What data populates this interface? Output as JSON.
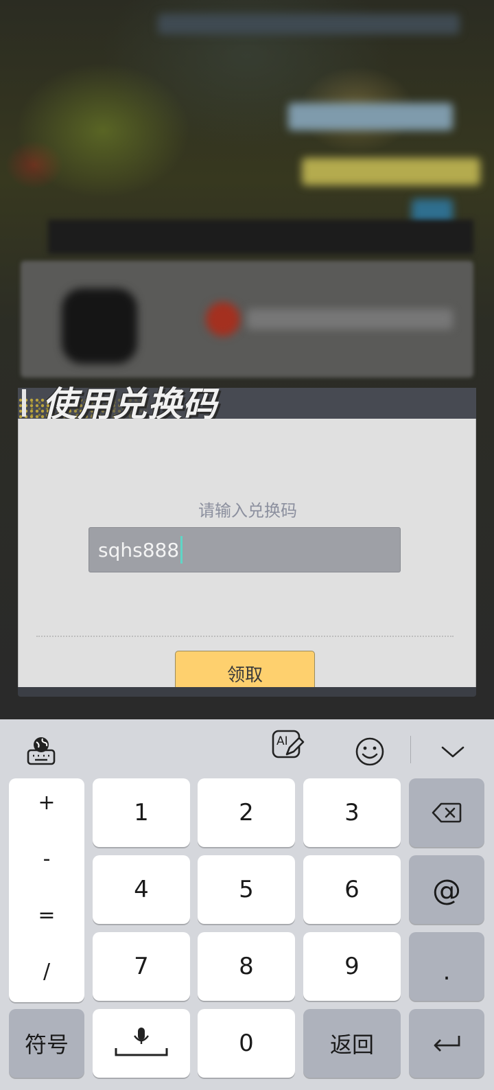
{
  "dialog": {
    "title": "使用兑换码",
    "prompt": "请输入兑换码",
    "input_value": "sqhs888",
    "claim_label": "领取"
  },
  "keyboard": {
    "toolbar": {
      "icons": [
        "keyboard-globe-icon",
        "ai-write-icon",
        "emoji-icon",
        "collapse-keyboard-icon"
      ],
      "ai_label": "AI"
    },
    "symbols": [
      "+",
      "-",
      "=",
      "/"
    ],
    "digits": [
      "1",
      "2",
      "3",
      "4",
      "5",
      "6",
      "7",
      "8",
      "9",
      "0"
    ],
    "at_key": "@",
    "dot_key": ".",
    "symbols_key": "符号",
    "back_key": "返回"
  },
  "colors": {
    "accent_yellow": "#fed06e",
    "caret": "#5fd6c6",
    "dialog_header": "#474a52",
    "keyboard_bg": "#d5d7dc",
    "func_key": "#aeb2bc"
  }
}
